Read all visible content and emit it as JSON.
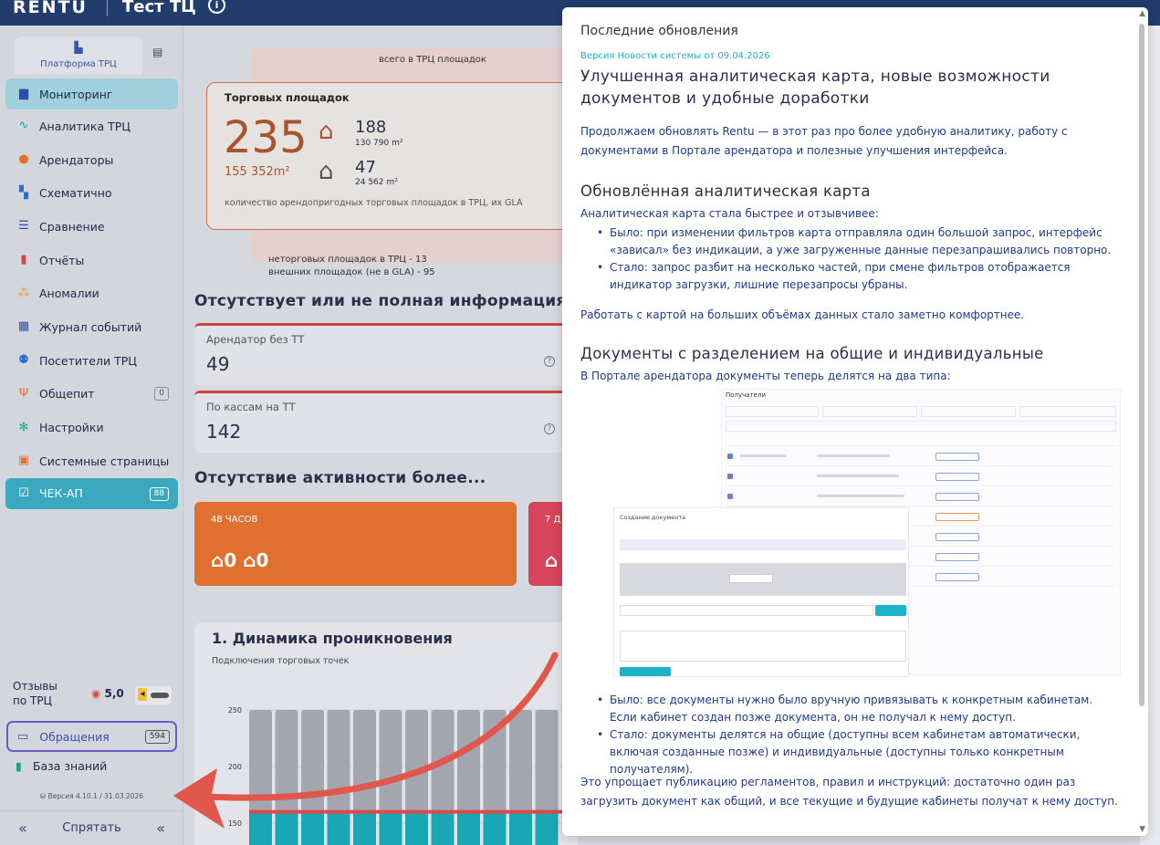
{
  "topbar": {
    "logo": "RENTU",
    "title": "Тест ТЦ",
    "info": "i"
  },
  "sidebar": {
    "tab_platform": "Платформа ТРЦ",
    "items": [
      {
        "label": "Мониторинг",
        "icon": "chart-icon"
      },
      {
        "label": "Аналитика ТРЦ",
        "icon": "pulse-icon"
      },
      {
        "label": "Арендаторы",
        "icon": "user-icon"
      },
      {
        "label": "Схематично",
        "icon": "map-icon"
      },
      {
        "label": "Сравнение",
        "icon": "compare-icon"
      },
      {
        "label": "Отчёты",
        "icon": "report-icon"
      },
      {
        "label": "Аномалии",
        "icon": "anomaly-icon"
      },
      {
        "label": "Журнал событий",
        "icon": "calendar-icon"
      },
      {
        "label": "Посетители ТРЦ",
        "icon": "visitors-icon"
      },
      {
        "label": "Общепит",
        "icon": "food-icon",
        "badge": "0"
      },
      {
        "label": "Настройки",
        "icon": "gear-icon"
      },
      {
        "label": "Системные страницы",
        "icon": "system-icon"
      },
      {
        "label": "ЧЕК-АП",
        "icon": "check-icon",
        "badge": "88"
      }
    ],
    "reviews_label": "Отзывы\nпо ТРЦ",
    "rating": "5,0",
    "appeals_label": "Обращения",
    "appeals_badge": "594",
    "kb_label": "База знаний",
    "version": "Версия 4.10.1 / 31.03.2026",
    "hide_label": "Спрятать"
  },
  "main": {
    "all_header": "всего в ТРЦ площадок",
    "gla_title": "Торговых площадок",
    "gla_total": "235",
    "gla_area": "155 352m²",
    "gla_n1": "188",
    "gla_a1": "130 790 m²",
    "gla_n2": "47",
    "gla_a2": "24 562 m²",
    "gla_desc": "количество арендопригодных торговых площадок в ТРЦ, их GLA",
    "note_line1": "неторговых площадок в ТРЦ - 13",
    "note_line2": "внешних площадок (не в GLA) - 95",
    "missing_title": "Отсутствует или не полная информация",
    "stat1_label": "Арендатор без ТТ",
    "stat1_value": "49",
    "stat2_label": "По кассам на ТТ",
    "stat2_value": "142",
    "inactive_title": "Отсутствие активности более...",
    "card1_title": "48 ЧАСОВ",
    "card1_v1": "0",
    "card1_v2": "0",
    "card2_title": "7 Д",
    "chart_title": "1. Динамика проникновения",
    "chart_subtitle": "Подключения торговых точек"
  },
  "chart_data": {
    "type": "bar",
    "title": "1. Динамика проникновения",
    "subtitle": "Подключения торговых точек",
    "yticks": [
      "250",
      "200",
      "150"
    ],
    "ylim": [
      150,
      250
    ],
    "categories": [
      "",
      "",
      "",
      "",
      "",
      "",
      "",
      "",
      "",
      "",
      "",
      ""
    ],
    "series": [
      {
        "values": [
          250,
          250,
          250,
          250,
          250,
          250,
          250,
          250,
          250,
          250,
          250,
          250
        ],
        "color": "#a3a6ae"
      },
      {
        "values": [
          160,
          160,
          160,
          160,
          160,
          160,
          160,
          160,
          160,
          160,
          160,
          160
        ],
        "color": "#1aa7b5"
      }
    ],
    "line_color": "#e04848"
  },
  "modal": {
    "header": "Последние обновления",
    "version": "Версия Новости системы от 09.04.2026",
    "h1": "Улучшенная аналитическая карта, новые возможности документов и удобные доработки",
    "intro": "Продолжаем обновлять Rentu — в этот раз про более удобную аналитику, работу с документами в Портале арендатора и полезные улучшения интерфейса.",
    "s1_title": "Обновлённая аналитическая карта",
    "s1_lead": "Аналитическая карта стала быстрее и отзывчивее:",
    "s1_b1": "Было: при изменении фильтров карта отправляла один большой запрос, интерфейс «зависал» без индикации, а уже загруженные данные перезапрашивались повторно.",
    "s1_b2": "Стало: запрос разбит на несколько частей, при смене фильтров отображается индикатор загрузки, лишние перезапросы убраны.",
    "s1_end": "Работать с картой на больших объёмах данных стало заметно комфортнее.",
    "s2_title": "Документы с разделением на общие и индивидуальные",
    "s2_lead": "В Портале арендатора документы теперь делятся на два типа:",
    "shot_title": "Получатели",
    "shot_form_title": "Создание документа",
    "s2_b1": "Было: все документы нужно было вручную привязывать к конкретным кабинетам. Если кабинет создан позже документа, он не получал к нему доступ.",
    "s2_b2": "Стало: документы делятся на общие (доступны всем кабинетам автоматически, включая созданные позже) и индивидуальные (доступны только конкретным получателям).",
    "s2_end": "Это упрощает публикацию регламентов, правил и инструкций: достаточно один раз загрузить документ как общий, и все текущие и будущие кабинеты получат к нему доступ."
  },
  "colors": {
    "accent": "#223d6b",
    "teal": "#1aa7b5",
    "orange": "#e0702f",
    "red_arrow": "#e2574c"
  }
}
